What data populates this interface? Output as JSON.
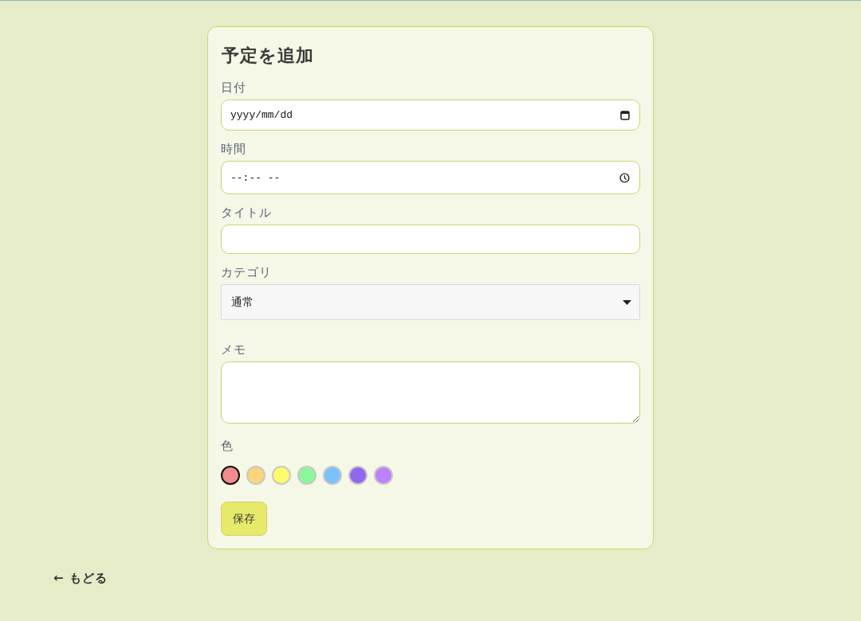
{
  "form": {
    "title": "予定を追加",
    "fields": [
      {
        "kind": "date",
        "label": "日付",
        "placeholder": "yyyy/mm/dd"
      },
      {
        "kind": "time",
        "label": "時間",
        "placeholder": "--:-- --"
      },
      {
        "kind": "text",
        "label": "タイトル"
      },
      {
        "kind": "select",
        "label": "カテゴリ",
        "value": "通常"
      },
      {
        "kind": "textarea",
        "label": "メモ"
      }
    ],
    "color": {
      "label": "色",
      "swatches": [
        {
          "color": "#f28c8c",
          "selected": true
        },
        {
          "color": "#fad57a",
          "selected": false
        },
        {
          "color": "#fffa6a",
          "selected": false
        },
        {
          "color": "#8bf79a",
          "selected": false
        },
        {
          "color": "#78c3fc",
          "selected": false
        },
        {
          "color": "#9167ee",
          "selected": false
        },
        {
          "color": "#bb82f9",
          "selected": false
        }
      ]
    },
    "save_button": "保存"
  },
  "back_link": "← もどる"
}
